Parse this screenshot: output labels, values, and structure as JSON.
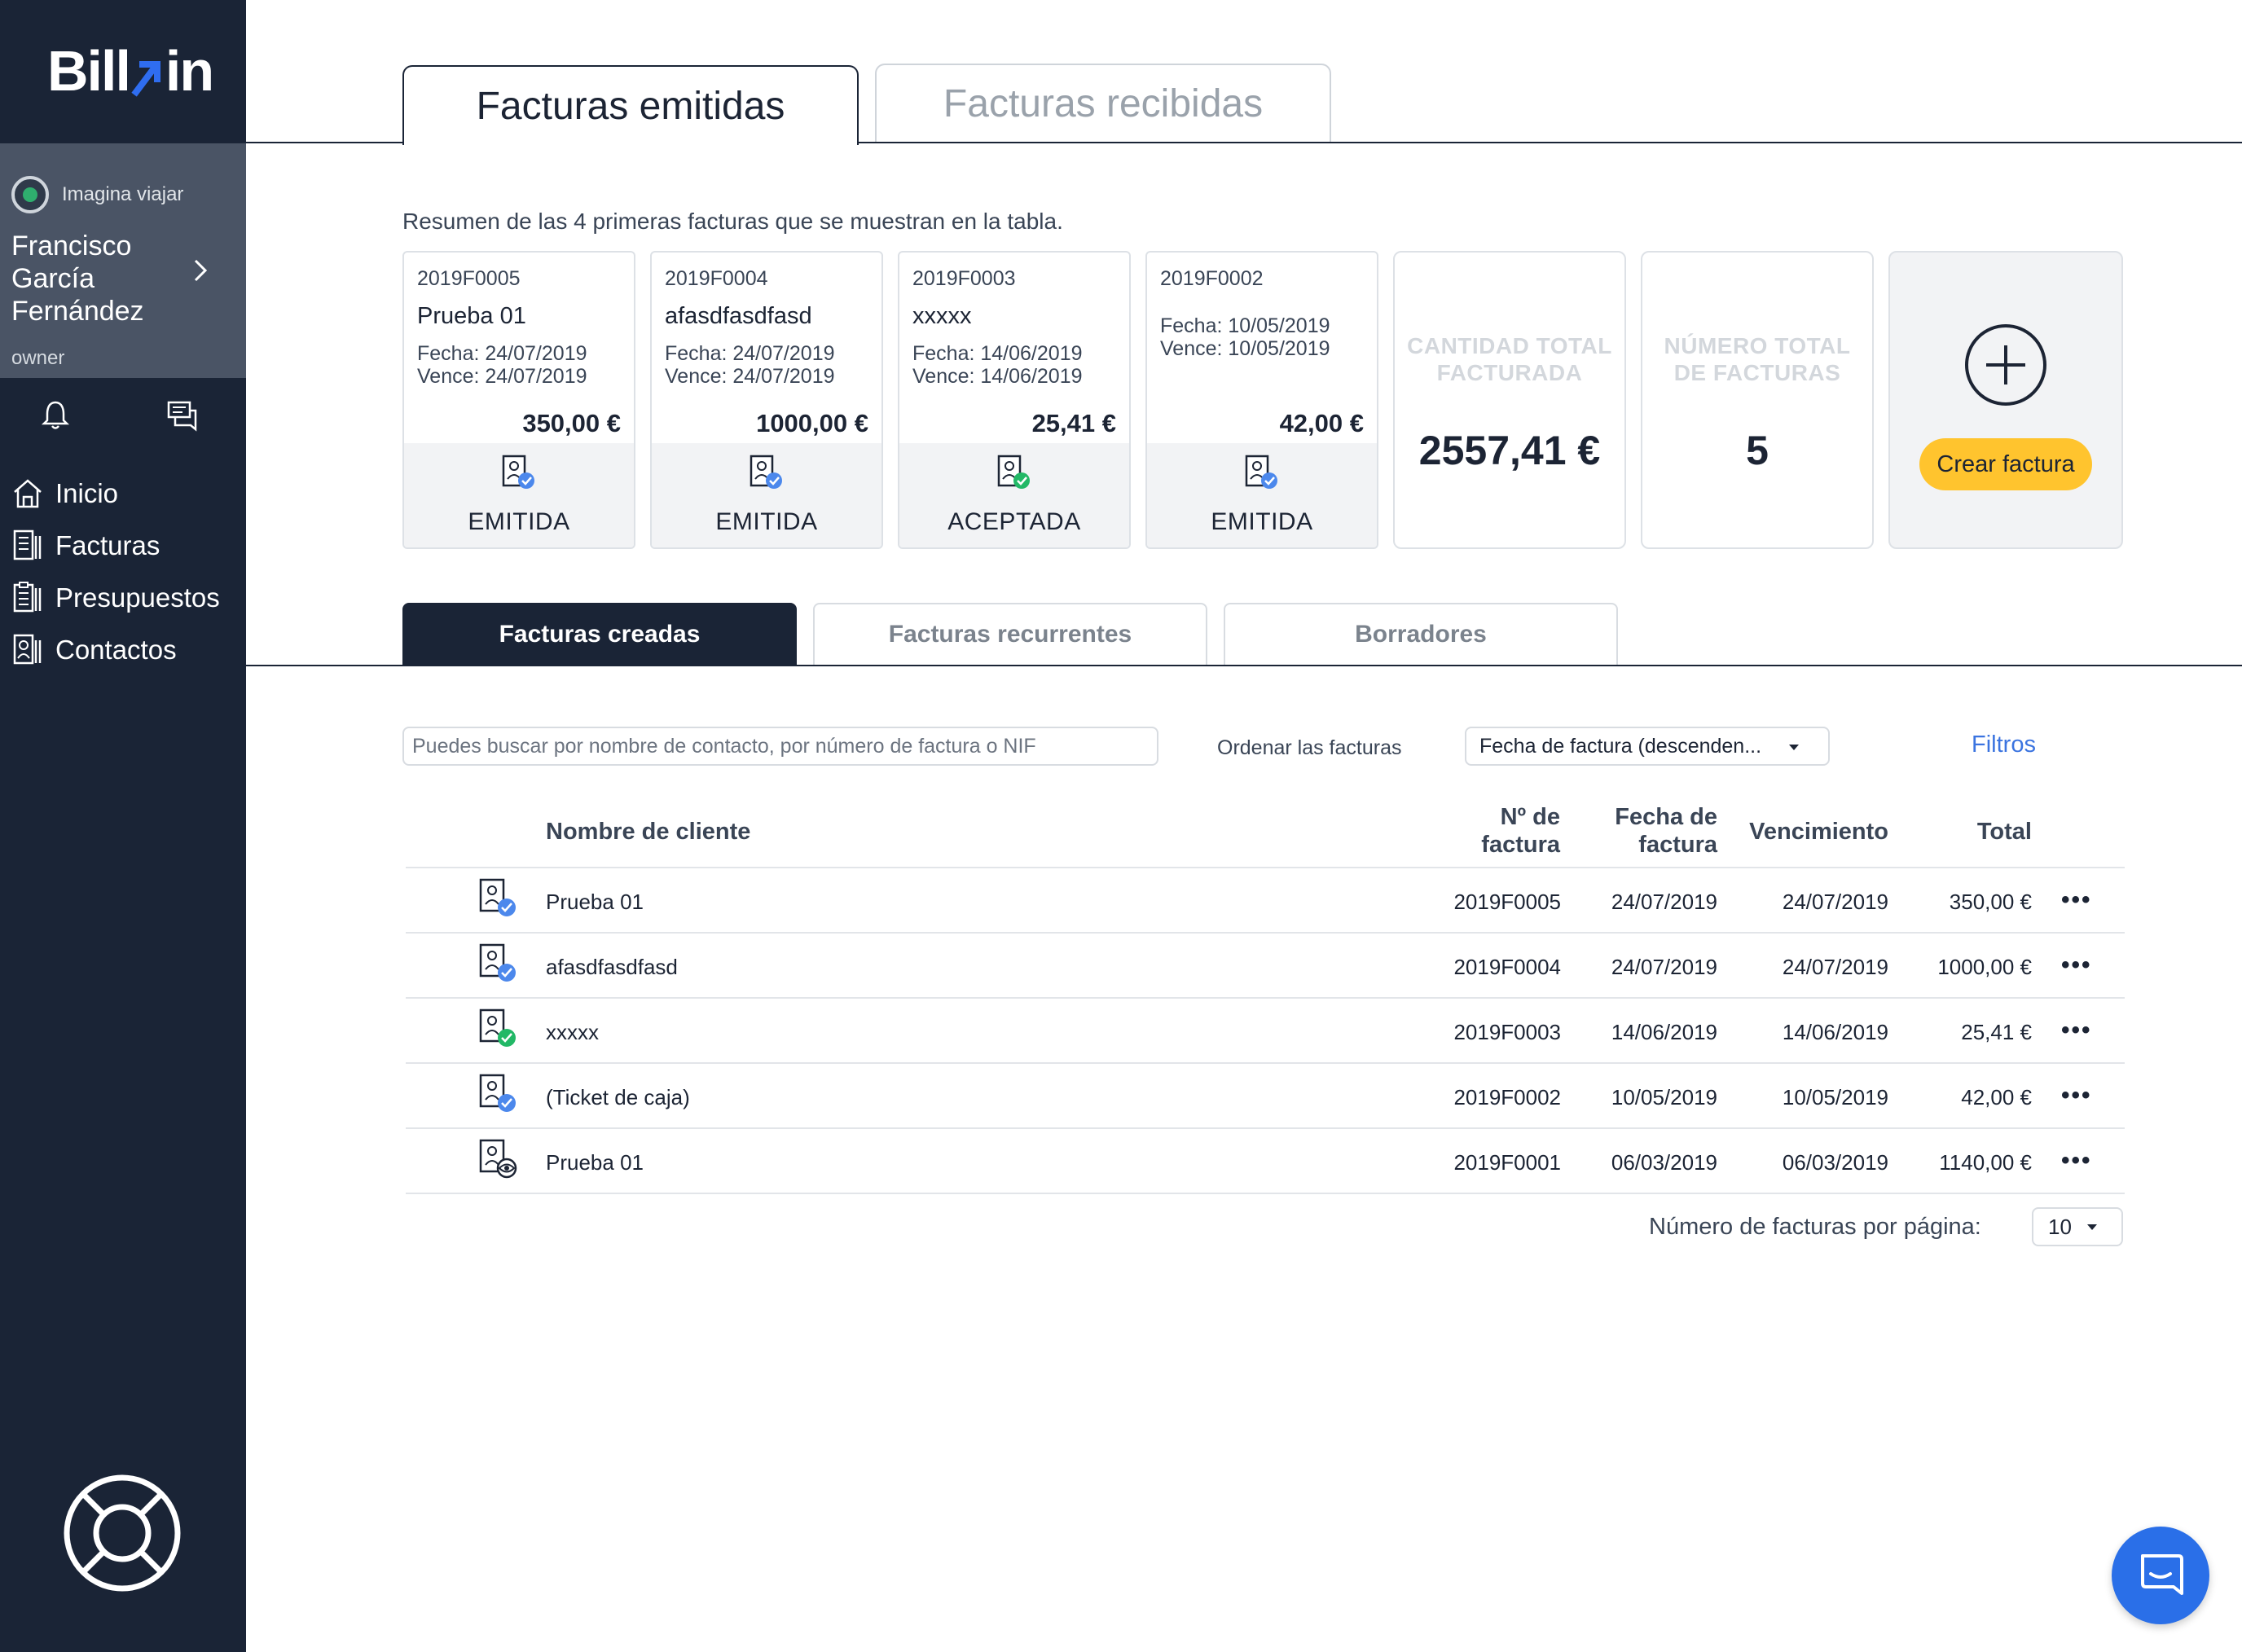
{
  "brand": {
    "logo_text_left": "Bill",
    "logo_text_right": "in",
    "accent": "#2f6df0",
    "sidebar_bg": "#1a2436",
    "warning_yellow": "#ffc42e",
    "link_blue": "#3b74e0"
  },
  "profile": {
    "company": "Imagina viajar",
    "user_name": "Francisco García Fernández",
    "role": "owner"
  },
  "nav": [
    {
      "label": "Inicio",
      "icon": "home-icon"
    },
    {
      "label": "Facturas",
      "icon": "invoice-icon"
    },
    {
      "label": "Presupuestos",
      "icon": "budget-icon"
    },
    {
      "label": "Contactos",
      "icon": "contacts-icon"
    }
  ],
  "top_tabs": {
    "emitidas": "Facturas emitidas",
    "recibidas": "Facturas recibidas"
  },
  "summary_note": "Resumen de las 4 primeras facturas que se muestran en la tabla.",
  "cards": [
    {
      "number": "2019F0005",
      "client": "Prueba 01",
      "fecha": "Fecha: 24/07/2019",
      "vence": "Vence: 24/07/2019",
      "amount": "350,00 €",
      "status": "EMITIDA"
    },
    {
      "number": "2019F0004",
      "client": "afasdfasdfasd",
      "fecha": "Fecha: 24/07/2019",
      "vence": "Vence: 24/07/2019",
      "amount": "1000,00 €",
      "status": "EMITIDA"
    },
    {
      "number": "2019F0003",
      "client": "xxxxx",
      "fecha": "Fecha: 14/06/2019",
      "vence": "Vence: 14/06/2019",
      "amount": "25,41 €",
      "status": "ACEPTADA"
    },
    {
      "number": "2019F0002",
      "client": "",
      "fecha": "Fecha: 10/05/2019",
      "vence": "Vence: 10/05/2019",
      "amount": "42,00 €",
      "status": "EMITIDA"
    }
  ],
  "stats": {
    "total_label": "CANTIDAD TOTAL FACTURADA",
    "total_value": "2557,41 €",
    "count_label": "NÚMERO TOTAL DE FACTURAS",
    "count_value": "5"
  },
  "create_button": "Crear factura",
  "sub_tabs": {
    "creadas": "Facturas creadas",
    "recurrentes": "Facturas recurrentes",
    "borradores": "Borradores"
  },
  "search": {
    "placeholder": "Puedes buscar por nombre de contacto, por número de factura o NIF"
  },
  "sort": {
    "label": "Ordenar las facturas",
    "selected": "Fecha de factura (descenden..."
  },
  "filters_link": "Filtros",
  "table": {
    "headers": {
      "client": "Nombre de cliente",
      "number_1": "Nº de",
      "number_2": "factura",
      "date_1": "Fecha de",
      "date_2": "factura",
      "due": "Vencimiento",
      "total": "Total"
    },
    "rows": [
      {
        "client": "Prueba 01",
        "number": "2019F0005",
        "date": "24/07/2019",
        "due": "24/07/2019",
        "total": "350,00 €",
        "state": "emitida",
        "more": "•••"
      },
      {
        "client": "afasdfasdfasd",
        "number": "2019F0004",
        "date": "24/07/2019",
        "due": "24/07/2019",
        "total": "1000,00 €",
        "state": "emitida",
        "more": "•••"
      },
      {
        "client": "xxxxx",
        "number": "2019F0003",
        "date": "14/06/2019",
        "due": "14/06/2019",
        "total": "25,41 €",
        "state": "aceptada",
        "more": "•••"
      },
      {
        "client": "(Ticket de caja)",
        "number": "2019F0002",
        "date": "10/05/2019",
        "due": "10/05/2019",
        "total": "42,00 €",
        "state": "emitida",
        "more": "•••"
      },
      {
        "client": "Prueba 01",
        "number": "2019F0001",
        "date": "06/03/2019",
        "due": "06/03/2019",
        "total": "1140,00 €",
        "state": "vista",
        "more": "•••"
      }
    ]
  },
  "pagination": {
    "label": "Número de facturas por página:",
    "value": "10"
  }
}
